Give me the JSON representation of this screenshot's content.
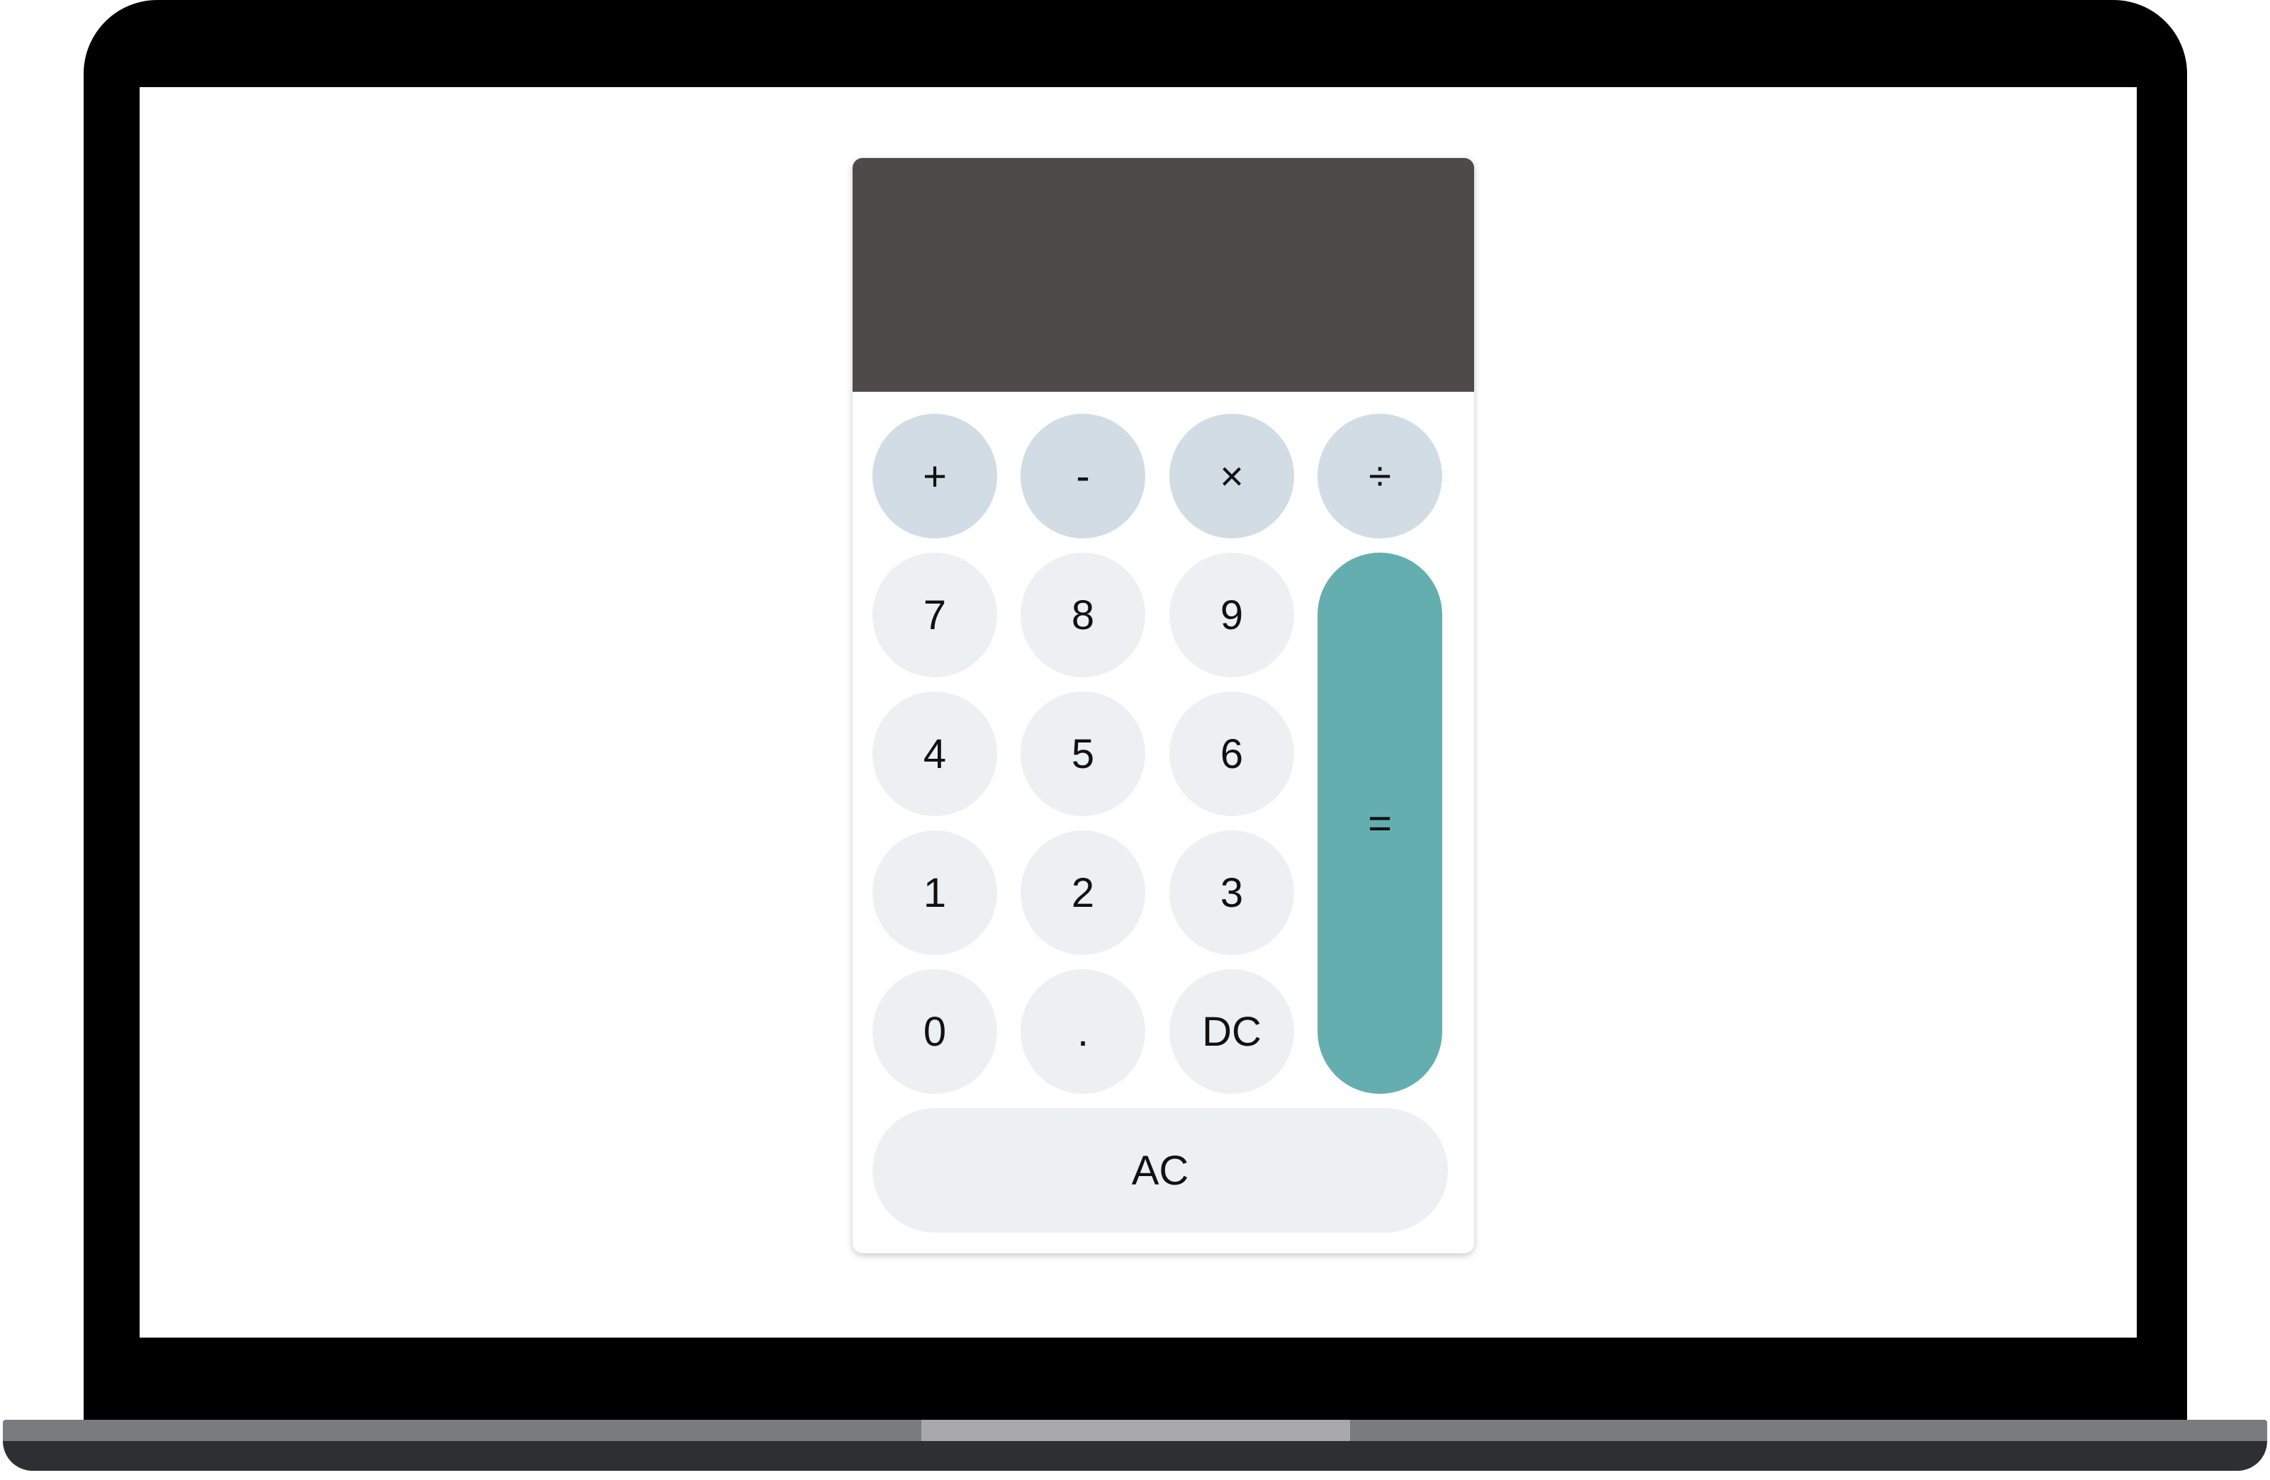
{
  "calculator": {
    "display_value": "",
    "colors": {
      "display_bg": "#4f4a4a",
      "operator_key_bg": "#d1dce4",
      "digit_key_bg": "#edf0f3",
      "equals_key_bg": "#64aeb0"
    },
    "operators": {
      "add": "+",
      "subtract": "-",
      "multiply": "×",
      "divide": "÷"
    },
    "digits": {
      "d7": "7",
      "d8": "8",
      "d9": "9",
      "d4": "4",
      "d5": "5",
      "d6": "6",
      "d1": "1",
      "d2": "2",
      "d3": "3",
      "d0": "0"
    },
    "decimal": ".",
    "delete": "DC",
    "equals": "=",
    "all_clear": "AC"
  }
}
